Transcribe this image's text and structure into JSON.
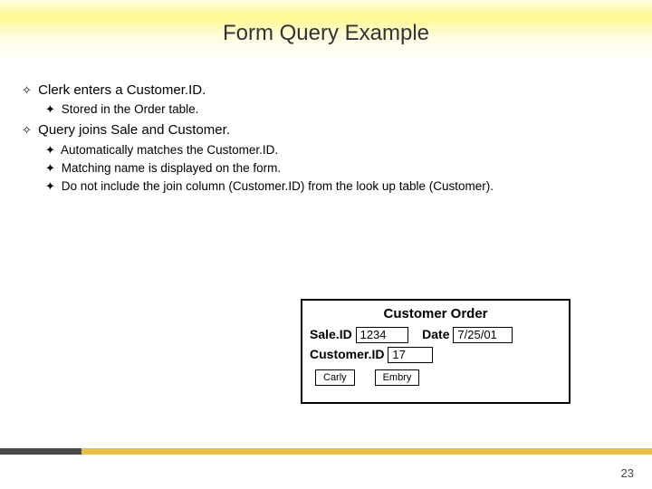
{
  "title": "Form Query Example",
  "bullets": {
    "l1_mark": "✧",
    "l2_mark": "✦",
    "b1a": "Clerk enters a Customer.ID.",
    "b1a_1": "Stored in the Order table.",
    "b1b": "Query joins Sale and Customer.",
    "b1b_1": "Automatically matches the Customer.ID.",
    "b1b_2": "Matching name is displayed on the form.",
    "b1b_3": "Do not include the join column (Customer.ID) from the look up table (Customer)."
  },
  "form": {
    "title": "Customer Order",
    "saleid_label": "Sale.ID",
    "saleid_value": "1234",
    "date_label": "Date",
    "date_value": "7/25/01",
    "custid_label": "Customer.ID",
    "custid_value": "17",
    "first_name": "Carly",
    "last_name": "Embry"
  },
  "page_number": "23"
}
